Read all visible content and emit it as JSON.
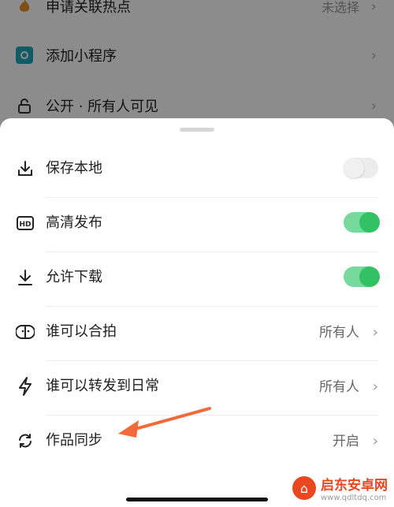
{
  "background": {
    "rows": [
      {
        "icon": "flame-icon",
        "label": "申请关联热点",
        "value": "未选择"
      },
      {
        "icon": "mini-program-icon",
        "label": "添加小程序",
        "value": ""
      },
      {
        "icon": "lock-icon",
        "label": "公开 · 所有人可见",
        "value": ""
      }
    ]
  },
  "sheet": {
    "rows": [
      {
        "icon": "download-tray-icon",
        "label": "保存本地",
        "control": "toggle",
        "enabled": false
      },
      {
        "icon": "hd-icon",
        "label": "高清发布",
        "control": "toggle",
        "enabled": true
      },
      {
        "icon": "download-arrow-icon",
        "label": "允许下载",
        "control": "toggle",
        "enabled": true
      },
      {
        "icon": "duet-face-icon",
        "label": "谁可以合拍",
        "control": "value",
        "value": "所有人"
      },
      {
        "icon": "lightning-icon",
        "label": "谁可以转发到日常",
        "control": "value",
        "value": "所有人"
      },
      {
        "icon": "sync-icon",
        "label": "作品同步",
        "control": "value",
        "value": "开启"
      }
    ]
  },
  "colors": {
    "toggle_on_track": "#77d99b",
    "toggle_on_knob": "#32c263",
    "arrow": "#f2693a"
  },
  "watermark": {
    "title": "启东安卓网",
    "url": "www.qdltdq.com"
  }
}
